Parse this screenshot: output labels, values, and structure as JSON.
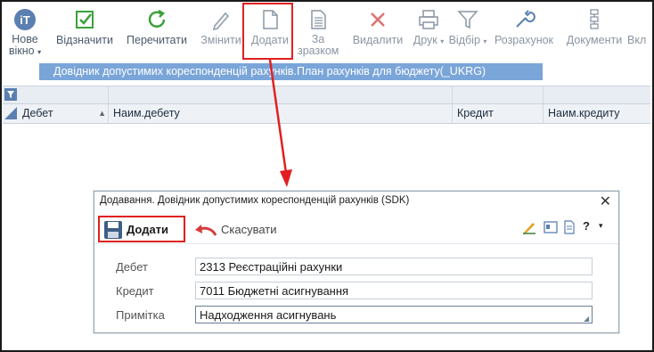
{
  "toolbar": {
    "new_window": "Нове вікно",
    "mark": "Відзначити",
    "reread": "Перечитати",
    "modify": "Змінити",
    "add": "Додати",
    "by_sample_1": "За",
    "by_sample_2": "зразком",
    "delete": "Видалити",
    "print": "Друк",
    "filter": "Відбір",
    "calc": "Розрахунок",
    "documents": "Документи",
    "incl": "Вкл"
  },
  "tab": {
    "title": "Довідник допустимих кореспонденцій рахунків.План рахунків для бюджету(_UKRG)"
  },
  "grid": {
    "columns": [
      "Дебет",
      "Наим.дебету",
      "Кредит",
      "Наим.кредиту"
    ]
  },
  "dialog": {
    "title": "Додавання. Довідник допустимих кореспонденцій рахунків (SDK)",
    "add_label": "Додати",
    "cancel_label": "Скасувати",
    "help": "?",
    "fields": {
      "debit_label": "Дебет",
      "debit_value": "2313 Реєстраційні рахунки",
      "credit_label": "Кредит",
      "credit_value": "7011 Бюджетні асигнування",
      "note_label": "Примітка",
      "note_value": "Надходження асигнувань"
    }
  },
  "colors": {
    "highlight": "#e02020",
    "tab_bg": "#7aa5d9",
    "accent_green": "#3aa23a",
    "accent_red": "#d83b3b"
  }
}
